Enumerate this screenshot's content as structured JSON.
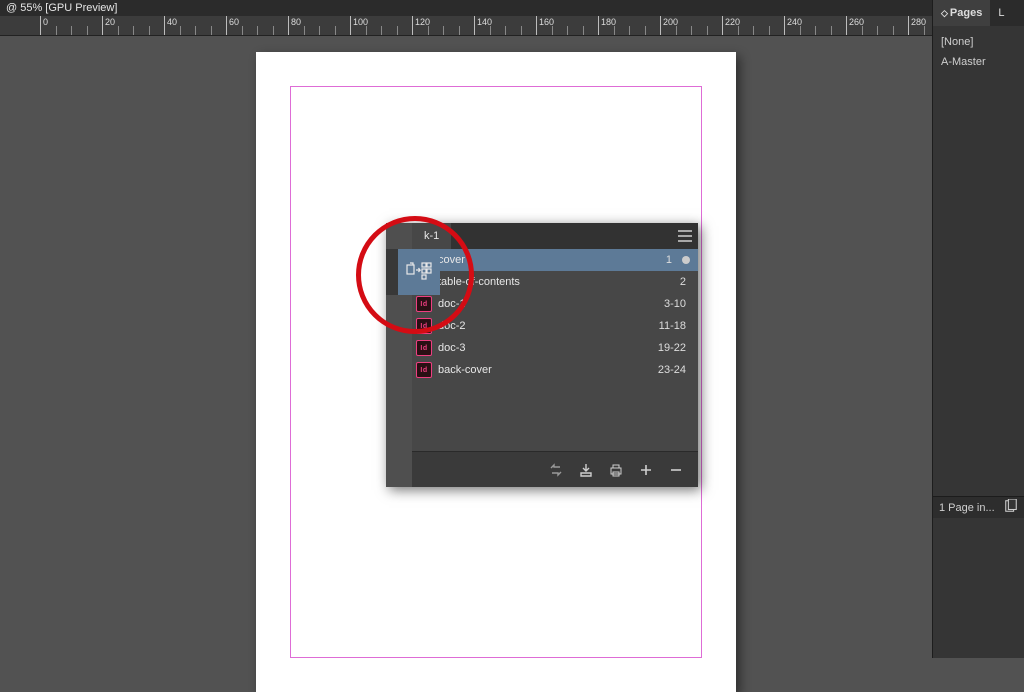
{
  "title_bar": {
    "label": "@ 55% [GPU Preview]"
  },
  "ruler": {
    "start": 0,
    "step": 20,
    "count": 15
  },
  "pages_panel": {
    "tab_active": "Pages",
    "tab_other": "L",
    "items": [
      "[None]",
      "A-Master"
    ],
    "footer": "1 Page in..."
  },
  "book_panel": {
    "tab_label": "k-1",
    "rows": [
      {
        "name": "cover",
        "pages": "1",
        "selected": true,
        "dot": true
      },
      {
        "name": "table-of-contents",
        "pages": "2",
        "selected": false,
        "dot": false
      },
      {
        "name": "doc-1",
        "pages": "3-10",
        "selected": false,
        "dot": false
      },
      {
        "name": "doc-2",
        "pages": "11-18",
        "selected": false,
        "dot": false
      },
      {
        "name": "doc-3",
        "pages": "19-22",
        "selected": false,
        "dot": false
      },
      {
        "name": "back-cover",
        "pages": "23-24",
        "selected": false,
        "dot": false
      }
    ]
  }
}
